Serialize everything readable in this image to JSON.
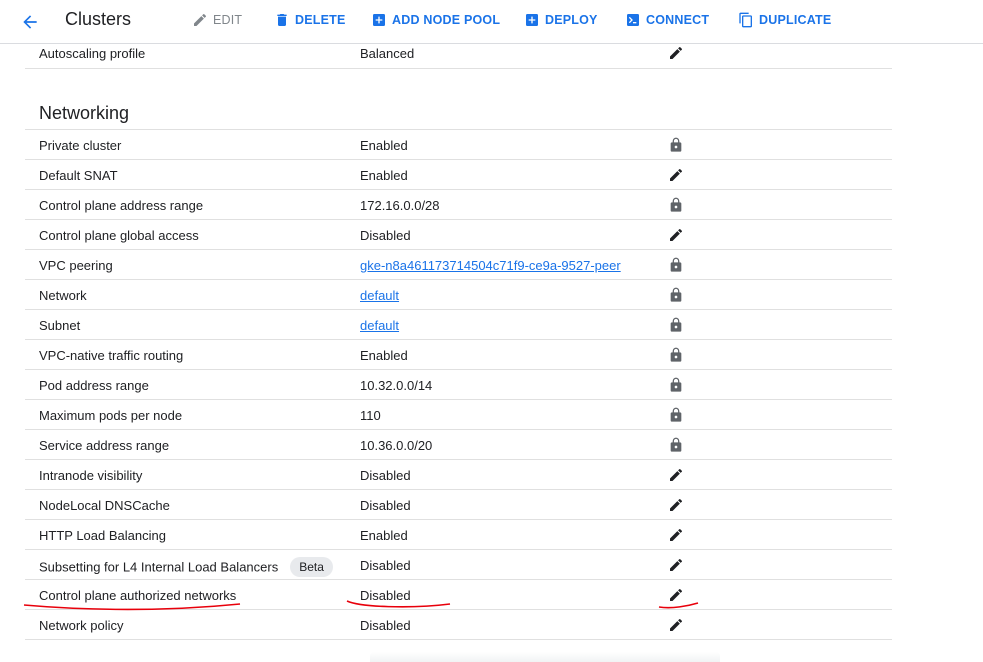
{
  "header": {
    "title": "Clusters",
    "actions": {
      "edit": "EDIT",
      "delete": "DELETE",
      "add_node_pool": "ADD NODE POOL",
      "deploy": "DEPLOY",
      "connect": "CONNECT",
      "duplicate": "DUPLICATE"
    }
  },
  "autoscaling": {
    "label": "Autoscaling profile",
    "value": "Balanced",
    "action": "edit"
  },
  "networking": {
    "title": "Networking",
    "rows": [
      {
        "label": "Private cluster",
        "value": "Enabled",
        "action": "lock"
      },
      {
        "label": "Default SNAT",
        "value": "Enabled",
        "action": "edit"
      },
      {
        "label": "Control plane address range",
        "value": "172.16.0.0/28",
        "action": "lock"
      },
      {
        "label": "Control plane global access",
        "value": "Disabled",
        "action": "edit"
      },
      {
        "label": "VPC peering",
        "value": "gke-n8a461173714504c71f9-ce9a-9527-peer",
        "action": "lock",
        "link": true
      },
      {
        "label": "Network",
        "value": "default",
        "action": "lock",
        "link": true
      },
      {
        "label": "Subnet",
        "value": "default",
        "action": "lock",
        "link": true
      },
      {
        "label": "VPC-native traffic routing",
        "value": "Enabled",
        "action": "lock"
      },
      {
        "label": "Pod address range",
        "value": "10.32.0.0/14",
        "action": "lock"
      },
      {
        "label": "Maximum pods per node",
        "value": "110",
        "action": "lock"
      },
      {
        "label": "Service address range",
        "value": "10.36.0.0/20",
        "action": "lock"
      },
      {
        "label": "Intranode visibility",
        "value": "Disabled",
        "action": "edit"
      },
      {
        "label": "NodeLocal DNSCache",
        "value": "Disabled",
        "action": "edit"
      },
      {
        "label": "HTTP Load Balancing",
        "value": "Enabled",
        "action": "edit"
      },
      {
        "label": "Subsetting for L4 Internal Load Balancers",
        "badge": "Beta",
        "value": "Disabled",
        "action": "edit"
      },
      {
        "label": "Control plane authorized networks",
        "value": "Disabled",
        "action": "edit"
      },
      {
        "label": "Network policy",
        "value": "Disabled",
        "action": "edit"
      }
    ]
  },
  "colors": {
    "accent": "#1a73e8",
    "disabled": "#80868b",
    "annotation": "#e8000b",
    "divider": "#e0e0e0"
  }
}
